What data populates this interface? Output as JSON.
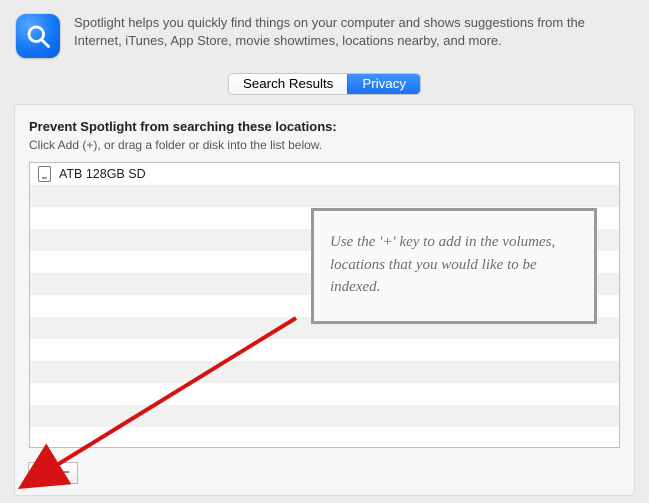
{
  "header": {
    "description": "Spotlight helps you quickly find things on your computer and shows suggestions from the Internet, iTunes, App Store, movie showtimes, locations nearby, and more."
  },
  "tabs": {
    "search_results": "Search Results",
    "privacy": "Privacy"
  },
  "panel": {
    "heading": "Prevent Spotlight from searching these locations:",
    "hint": "Click Add (+), or drag a folder or disk into the list below."
  },
  "list": {
    "items": [
      {
        "label": "ATB 128GB SD"
      }
    ]
  },
  "buttons": {
    "add": "+",
    "remove": "−"
  },
  "annotation": {
    "text": "Use the '+' key to add in the volumes, locations that you would like to be indexed."
  }
}
